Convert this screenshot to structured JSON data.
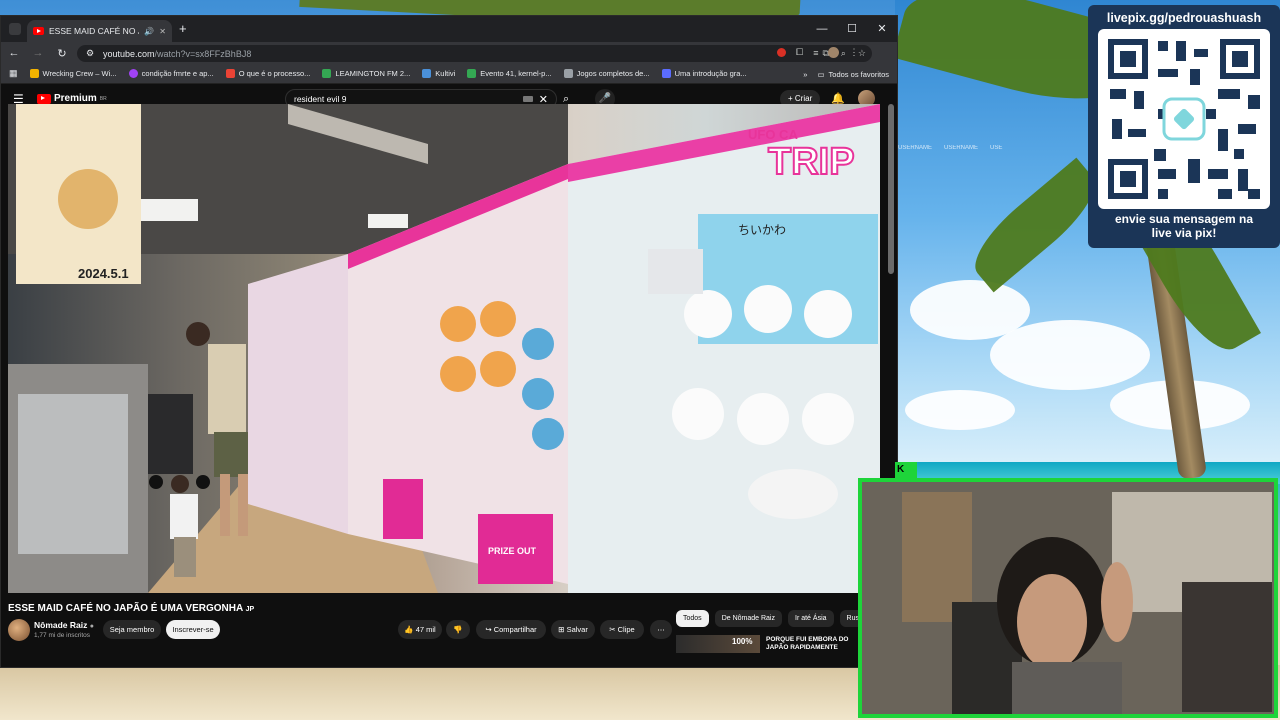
{
  "browser": {
    "tab_title": "ESSE MAID CAFÉ NO JAPÃO",
    "url_host": "youtube.com",
    "url_path": "/watch?v=sx8FFzBhBJ8",
    "bookmarks": [
      {
        "label": "Wrecking Crew – Wi...",
        "color": "#f4b400"
      },
      {
        "label": "condição fmrte e ap...",
        "color": "#a142f4"
      },
      {
        "label": "O que é o processo...",
        "color": "#ea4335"
      },
      {
        "label": "LEAMINGTON FM 2...",
        "color": "#34a853"
      },
      {
        "label": "Kultivi",
        "color": "#4a90d9"
      },
      {
        "label": "Evento 41, kernel-p...",
        "color": "#34a853"
      },
      {
        "label": "Jogos completos de...",
        "color": "#9aa0a6"
      },
      {
        "label": "Uma introdução gra...",
        "color": "#5b6cff"
      }
    ],
    "bookmarks_more": "»",
    "all_favorites": "Todos os favoritos"
  },
  "youtube": {
    "logo_text": "Premium",
    "logo_sup": "BR",
    "search_value": "resident evil 9",
    "create_label": "Criar",
    "video_title": "ESSE MAID CAFÉ NO JAPÃO É UMA VERGONHA",
    "video_title_suffix": "JP",
    "channel_name": "Nômade Raiz",
    "channel_subs": "1,77 mi de inscritos",
    "join_label": "Seja membro",
    "subscribe_label": "Inscrever-se",
    "likes_label": "47 mil",
    "share_label": "Compartilhar",
    "save_label": "Salvar",
    "clip_label": "Clipe",
    "chips": [
      "Todos",
      "De Nômade Raiz",
      "Ir até Ásia",
      "Rus"
    ],
    "rec_badge": "100%",
    "rec_title": "PORQUE FUI EMBORA DO JAPÃO RAPIDAMENTE"
  },
  "overlay": {
    "qr_url": "livepix.gg/pedrouashuash",
    "qr_message_line1": "envie sua mensagem na",
    "qr_message_line2": "live via pix!",
    "usernames": [
      "USERNAME",
      "USERNAME",
      "USE"
    ],
    "cam_label": "K"
  },
  "video_scene": {
    "sign_top": "UFO CA",
    "sign_main": "TRIP",
    "banner_text": "ちいかわ",
    "prize_label": "PRIZE OUT",
    "date_text": "2024.5.1"
  }
}
